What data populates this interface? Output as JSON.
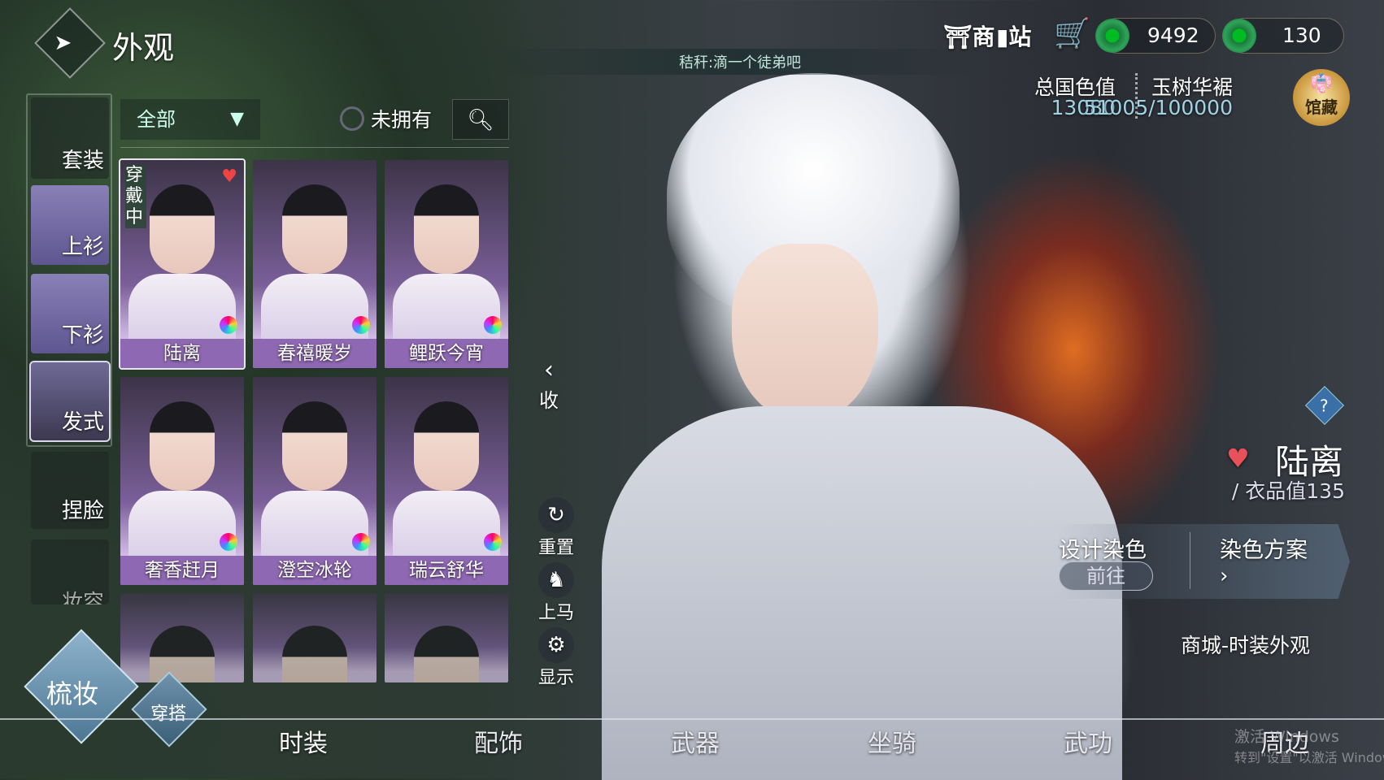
{
  "header": {
    "title": "外观",
    "back_icon": "back-arrow-icon"
  },
  "chat_banner": "秸秆:滴一个徒弟吧",
  "topbar": {
    "shop_label": "商",
    "station_label": "站",
    "cart_icon": "cart-icon",
    "currencies": [
      {
        "icon": "jade-coin-icon",
        "value": "9492"
      },
      {
        "icon": "jade-coin-icon",
        "value": "130"
      }
    ]
  },
  "stats": {
    "total_label": "总国色值",
    "total_value": "13080",
    "collection_label": "玉树华裾",
    "collection_value": "51005/100000",
    "collection_progress": 0.51005,
    "museum_label": "馆藏"
  },
  "sidebar": {
    "items": [
      {
        "label": "套装"
      },
      {
        "label": "上衫"
      },
      {
        "label": "下衫"
      },
      {
        "label": "发式",
        "selected": true
      },
      {
        "label": "捏脸"
      },
      {
        "label": "妆容"
      }
    ]
  },
  "filter": {
    "category": "全部",
    "unowned_label": "未拥有",
    "unowned_checked": false
  },
  "grid": {
    "wearing_label": "穿戴中",
    "items": [
      {
        "name": "陆离",
        "wearing": true,
        "favorite": true
      },
      {
        "name": "春禧暖岁"
      },
      {
        "name": "鲤跃今宵"
      },
      {
        "name": "奢香赶月"
      },
      {
        "name": "澄空冰轮"
      },
      {
        "name": "瑞云舒华"
      },
      {
        "name": ""
      },
      {
        "name": ""
      },
      {
        "name": ""
      }
    ]
  },
  "collapse_label": "收",
  "actions": [
    {
      "label": "重置",
      "icon": "reset-icon"
    },
    {
      "label": "上马",
      "icon": "horse-icon"
    },
    {
      "label": "显示",
      "icon": "gear-icon"
    }
  ],
  "detail": {
    "name": "陆离",
    "quality": "/ 衣品值135",
    "design_dye": "设计染色",
    "go_label": "前往",
    "dye_scheme": "染色方案",
    "shop_link": "商城-时装外观"
  },
  "modes": {
    "primary": "梳妆",
    "secondary": "穿搭"
  },
  "tabs": [
    "时装",
    "配饰",
    "武器",
    "坐骑",
    "武功",
    "周边"
  ],
  "watermark": {
    "line1": "激活 Windows",
    "line2": "转到\"设置\"以激活 Windows。"
  }
}
